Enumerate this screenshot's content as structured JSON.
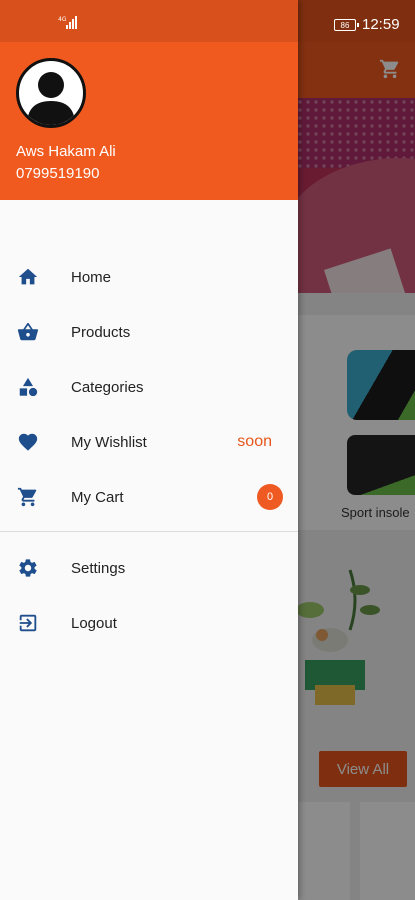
{
  "status_bar": {
    "signal_label": "4G",
    "battery": "86",
    "time": "12:59"
  },
  "user": {
    "name": "Aws Hakam Ali",
    "phone": "0799519190"
  },
  "menu": [
    {
      "label": "Home",
      "icon": "home-icon"
    },
    {
      "label": "Products",
      "icon": "basket-icon"
    },
    {
      "label": "Categories",
      "icon": "shapes-icon"
    },
    {
      "label": "My Wishlist",
      "icon": "heart-icon",
      "tag": "soon"
    },
    {
      "label": "My Cart",
      "icon": "cart-icon",
      "badge": "0"
    },
    {
      "label": "Settings",
      "icon": "gear-icon"
    },
    {
      "label": "Logout",
      "icon": "logout-icon"
    }
  ],
  "background": {
    "product_label": "Sport insole",
    "view_all": "View All"
  },
  "colors": {
    "accent": "#f05a1f",
    "icon": "#1f4e8c"
  }
}
